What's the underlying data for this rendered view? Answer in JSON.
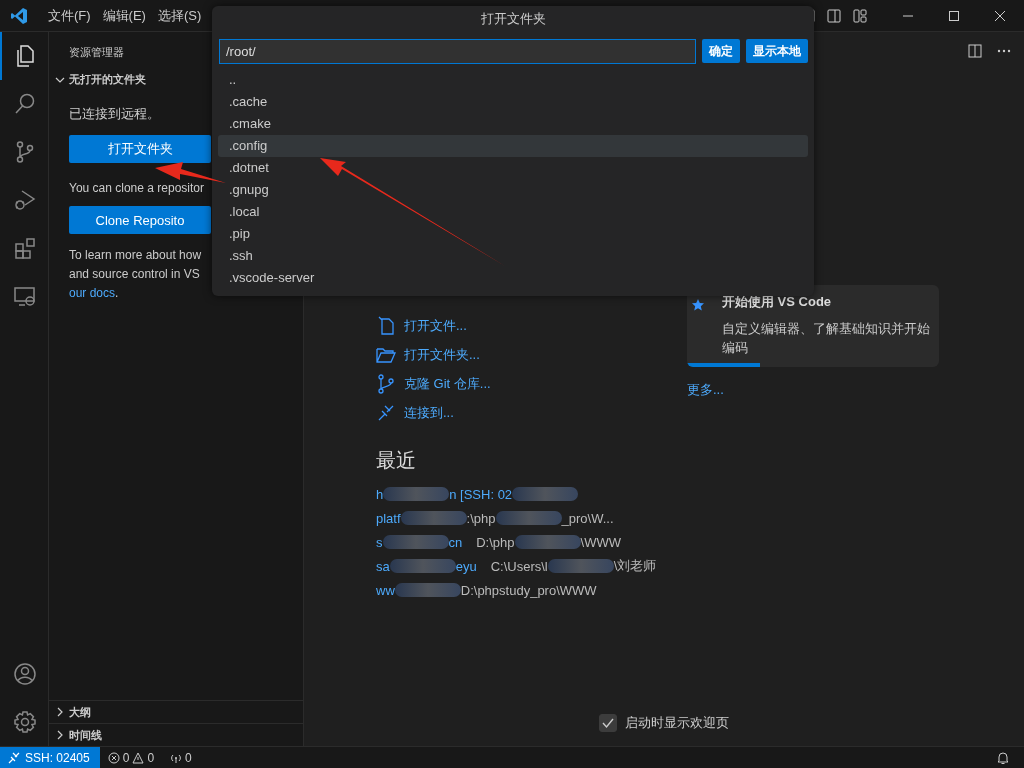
{
  "title_bar": {
    "menus": [
      "文件(F)",
      "编辑(E)",
      "选择(S)"
    ]
  },
  "activity_bar": {
    "items": [
      {
        "kind": "explorer",
        "selected": true
      },
      {
        "kind": "search",
        "selected": false
      },
      {
        "kind": "source-control",
        "selected": false
      },
      {
        "kind": "run-debug",
        "selected": false
      },
      {
        "kind": "extensions",
        "selected": false
      },
      {
        "kind": "remote",
        "selected": false
      }
    ],
    "bottom": [
      {
        "kind": "account"
      },
      {
        "kind": "settings"
      }
    ]
  },
  "sidebar": {
    "title": "资源管理器",
    "section": {
      "title": "无打开的文件夹",
      "expanded": true
    },
    "connected_text": "已连接到远程。",
    "open_folder_button": "打开文件夹",
    "clone_text": "You can clone a repositor",
    "clone_button": "Clone Reposito",
    "learn_lines": [
      "To learn more about how",
      "and source control in VS"
    ],
    "docs_link": "our docs",
    "docs_tail": ".",
    "panels": [
      {
        "title": "大纲",
        "expanded": false
      },
      {
        "title": "时间线",
        "expanded": false
      }
    ]
  },
  "welcome": {
    "start": [
      {
        "kind": "open-file",
        "label": "打开文件..."
      },
      {
        "kind": "open-folder",
        "label": "打开文件夹..."
      },
      {
        "kind": "clone",
        "label": "克隆 Git 仓库..."
      },
      {
        "kind": "connect",
        "label": "连接到..."
      }
    ],
    "recent_title": "最近",
    "recent": [
      {
        "segments": [
          {
            "kind": "name",
            "text": "h"
          },
          {
            "kind": "blur"
          },
          {
            "kind": "name",
            "text": "n [SSH: 02"
          },
          {
            "kind": "blur"
          }
        ]
      },
      {
        "segments": [
          {
            "kind": "name",
            "text": "platf"
          },
          {
            "kind": "blur"
          },
          {
            "kind": "path",
            "text": ":\\php"
          },
          {
            "kind": "blur"
          },
          {
            "kind": "path",
            "text": "_pro\\W..."
          }
        ]
      },
      {
        "segments": [
          {
            "kind": "name",
            "text": "s"
          },
          {
            "kind": "blur"
          },
          {
            "kind": "name",
            "text": "cn"
          },
          {
            "kind": "path",
            "text": "D:\\php"
          },
          {
            "kind": "blur"
          },
          {
            "kind": "path",
            "text": "\\WWW"
          }
        ]
      },
      {
        "segments": [
          {
            "kind": "name",
            "text": "sa"
          },
          {
            "kind": "blur"
          },
          {
            "kind": "name",
            "text": "eyu"
          },
          {
            "kind": "path",
            "text": "C:\\Users\\l"
          },
          {
            "kind": "blur"
          },
          {
            "kind": "path",
            "text": "\\刘老师"
          }
        ]
      },
      {
        "segments": [
          {
            "kind": "name",
            "text": "ww"
          },
          {
            "kind": "blur"
          },
          {
            "kind": "path",
            "text": "D:\\phpstudy_pro\\WWW"
          }
        ]
      }
    ],
    "walkthrough": {
      "title": "开始使用 VS Code",
      "description": "自定义编辑器、了解基础知识并开始编码",
      "level": 0.29
    },
    "more_link": "更多...",
    "show_on_startup": {
      "label": "启动时显示欢迎页",
      "checked": true
    }
  },
  "dialog": {
    "title": "打开文件夹",
    "path": "/root/",
    "buttons": [
      "确定",
      "显示本地"
    ],
    "items": [
      {
        "label": "..",
        "selected": false
      },
      {
        "label": ".cache",
        "selected": false
      },
      {
        "label": ".cmake",
        "selected": false
      },
      {
        "label": ".config",
        "selected": true
      },
      {
        "label": ".dotnet",
        "selected": false
      },
      {
        "label": ".gnupg",
        "selected": false
      },
      {
        "label": ".local",
        "selected": false
      },
      {
        "label": ".pip",
        "selected": false
      },
      {
        "label": ".ssh",
        "selected": false
      },
      {
        "label": ".vscode-server",
        "selected": false
      }
    ]
  },
  "status_bar": {
    "remote": "SSH: 02405",
    "errors": "0",
    "warnings": "0",
    "ports": "0"
  }
}
